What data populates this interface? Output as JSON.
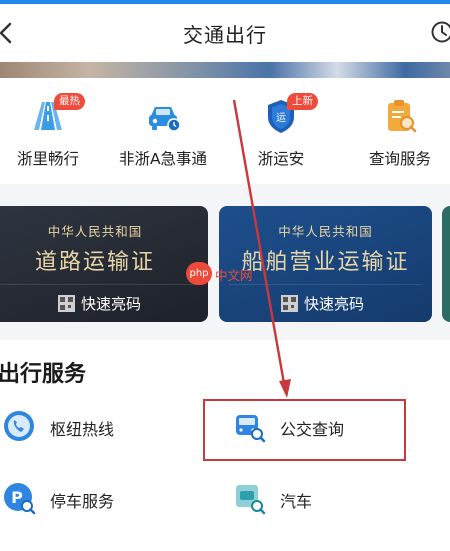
{
  "header": {
    "title": "交通出行",
    "back_icon": "chevron-left-icon",
    "right_icon": "clock-icon"
  },
  "quick_links": [
    {
      "label": "浙里畅行",
      "badge": "最热",
      "icon": "road-icon"
    },
    {
      "label": "非浙A急事通",
      "badge": "",
      "icon": "car-icon"
    },
    {
      "label": "浙运安",
      "badge": "上新",
      "icon": "shield-icon"
    },
    {
      "label": "查询服务",
      "badge": "",
      "icon": "clipboard-search-icon"
    }
  ],
  "certificates": [
    {
      "issuer": "中华人民共和国",
      "name": "道路运输证",
      "action": "快速亮码"
    },
    {
      "issuer": "中华人民共和国",
      "name": "船舶营业运输证",
      "action": "快速亮码"
    }
  ],
  "services": {
    "section_title": "出行服务",
    "items": [
      {
        "label": "枢纽热线",
        "icon": "phone-icon"
      },
      {
        "label": "公交查询",
        "icon": "bus-search-icon"
      },
      {
        "label": "停车服务",
        "icon": "parking-search-icon"
      },
      {
        "label": "汽车",
        "icon": "car-search-icon"
      }
    ]
  },
  "watermark": {
    "circle": "php",
    "text": "中文网"
  },
  "colors": {
    "accent": "#1f86ea",
    "badge": "#ef4b3c",
    "highlight": "#c8383c",
    "gold": "#e9d6a8"
  }
}
